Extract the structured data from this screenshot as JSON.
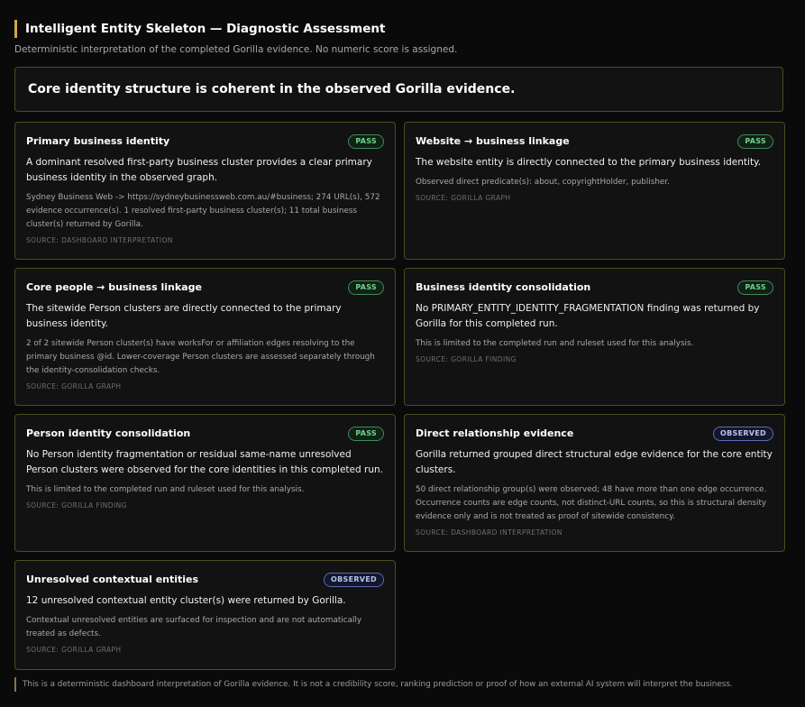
{
  "header": {
    "title": "Intelligent Entity Skeleton — Diagnostic Assessment",
    "subtitle": "Deterministic interpretation of the completed Gorilla evidence. No numeric score is assigned."
  },
  "summary": {
    "headline": "Core identity structure is coherent in the observed Gorilla evidence."
  },
  "cards": [
    {
      "title": "Primary business identity",
      "status": "PASS",
      "main": "A dominant resolved first-party business cluster provides a clear primary business identity in the observed graph.",
      "detail": "Sydney Business Web -> https://sydneybusinessweb.com.au/#business; 274 URL(s), 572 evidence occurrence(s). 1 resolved first-party business cluster(s); 11 total business cluster(s) returned by Gorilla.",
      "source": "SOURCE: DASHBOARD INTERPRETATION"
    },
    {
      "title": "Website → business linkage",
      "status": "PASS",
      "main": "The website entity is directly connected to the primary business identity.",
      "detail": "Observed direct predicate(s): about, copyrightHolder, publisher.",
      "source": "SOURCE: GORILLA GRAPH"
    },
    {
      "title": "Core people → business linkage",
      "status": "PASS",
      "main": "The sitewide Person clusters are directly connected to the primary business identity.",
      "detail": "2 of 2 sitewide Person cluster(s) have worksFor or affiliation edges resolving to the primary business @id. Lower-coverage Person clusters are assessed separately through the identity-consolidation checks.",
      "source": "SOURCE: GORILLA GRAPH"
    },
    {
      "title": "Business identity consolidation",
      "status": "PASS",
      "main": "No PRIMARY_ENTITY_IDENTITY_FRAGMENTATION finding was returned by Gorilla for this completed run.",
      "detail": "This is limited to the completed run and ruleset used for this analysis.",
      "source": "SOURCE: GORILLA FINDING"
    },
    {
      "title": "Person identity consolidation",
      "status": "PASS",
      "main": "No Person identity fragmentation or residual same-name unresolved Person clusters were observed for the core identities in this completed run.",
      "detail": "This is limited to the completed run and ruleset used for this analysis.",
      "source": "SOURCE: GORILLA FINDING"
    },
    {
      "title": "Direct relationship evidence",
      "status": "OBSERVED",
      "main": "Gorilla returned grouped direct structural edge evidence for the core entity clusters.",
      "detail": "50 direct relationship group(s) were observed; 48 have more than one edge occurrence. Occurrence counts are edge counts, not distinct-URL counts, so this is structural density evidence only and is not treated as proof of sitewide consistency.",
      "source": "SOURCE: DASHBOARD INTERPRETATION"
    },
    {
      "title": "Unresolved contextual entities",
      "status": "OBSERVED",
      "main": "12 unresolved contextual entity cluster(s) were returned by Gorilla.",
      "detail": "Contextual unresolved entities are surfaced for inspection and are not automatically treated as defects.",
      "source": "SOURCE: GORILLA GRAPH"
    }
  ],
  "footer": {
    "text": "This is a deterministic dashboard interpretation of Gorilla evidence. It is not a credibility score, ranking prediction or proof of how an external AI system will interpret the business."
  },
  "colors": {
    "accent": "#d2a64a",
    "card_border": "#4b4d20",
    "pass": "#6fd38a",
    "observed": "#b8c4f2"
  }
}
